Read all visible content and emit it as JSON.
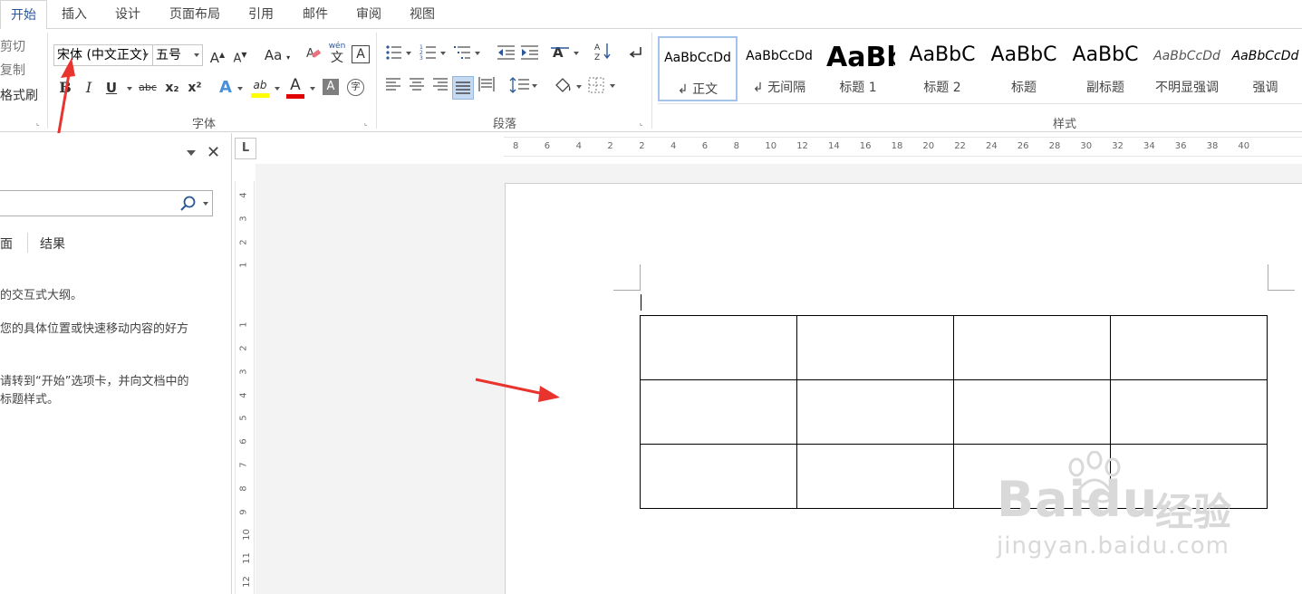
{
  "tabs": [
    "开始",
    "插入",
    "设计",
    "页面布局",
    "引用",
    "邮件",
    "审阅",
    "视图"
  ],
  "clipboard": {
    "cut": "剪切",
    "copy": "复制",
    "format_painter": "格式刷"
  },
  "font": {
    "family_value": "宋体 (中文正文)",
    "size_value": "五号",
    "grow": "A",
    "shrink": "A",
    "change_case": "Aa",
    "phonetic": "wén",
    "border_char": "A",
    "italic": "I",
    "underline": "U",
    "strike": "abc",
    "sub": "x₂",
    "sup": "x²",
    "effects": "A",
    "highlight": "ab",
    "color": "A",
    "shade": "A",
    "enclose": "字",
    "group_label": "字体"
  },
  "paragraph": {
    "group_label": "段落"
  },
  "styles": {
    "group_label": "样式",
    "items": [
      {
        "sample": "AaBbCcDd",
        "name": "↲ 正文"
      },
      {
        "sample": "AaBbCcDd",
        "name": "↲ 无间隔"
      },
      {
        "sample": "AaBb",
        "name": "标题 1"
      },
      {
        "sample": "AaBbC",
        "name": "标题 2"
      },
      {
        "sample": "AaBbC",
        "name": "标题"
      },
      {
        "sample": "AaBbC",
        "name": "副标题"
      },
      {
        "sample": "AaBbCcDd",
        "name": "不明显强调"
      },
      {
        "sample": "AaBbCcDd",
        "name": "强调"
      }
    ]
  },
  "nav_pane": {
    "tab_pages": "页面",
    "tab_results": "结果",
    "line1": "的交互式大纲。",
    "line2": "您的具体位置或快速移动内容的好方",
    "line3": "请转到“开始”选项卡，并向文档中的",
    "line4": "标题样式。"
  },
  "hruler_ticks": [
    "8",
    "6",
    "4",
    "2",
    "2",
    "4",
    "6",
    "8",
    "10",
    "12",
    "14",
    "16",
    "18",
    "20",
    "22",
    "24",
    "26",
    "28",
    "30",
    "32",
    "34",
    "36",
    "38",
    "40"
  ],
  "vruler_ticks": [
    "4",
    "3",
    "2",
    "1",
    "1",
    "2",
    "3",
    "4",
    "5",
    "6",
    "7",
    "8",
    "9",
    "10",
    "11",
    "12"
  ],
  "ruler_corner": "L",
  "table": {
    "rows": 3,
    "cols": 4
  },
  "watermark": {
    "brand_a": "Bai",
    "brand_b": "du",
    "brand_cn": "经验",
    "url": "jingyan.baidu.com"
  },
  "colors": {
    "accent": "#2b579a",
    "arrow": "#e8332e",
    "highlight": "#ffff00",
    "font_color": "#e00000"
  }
}
